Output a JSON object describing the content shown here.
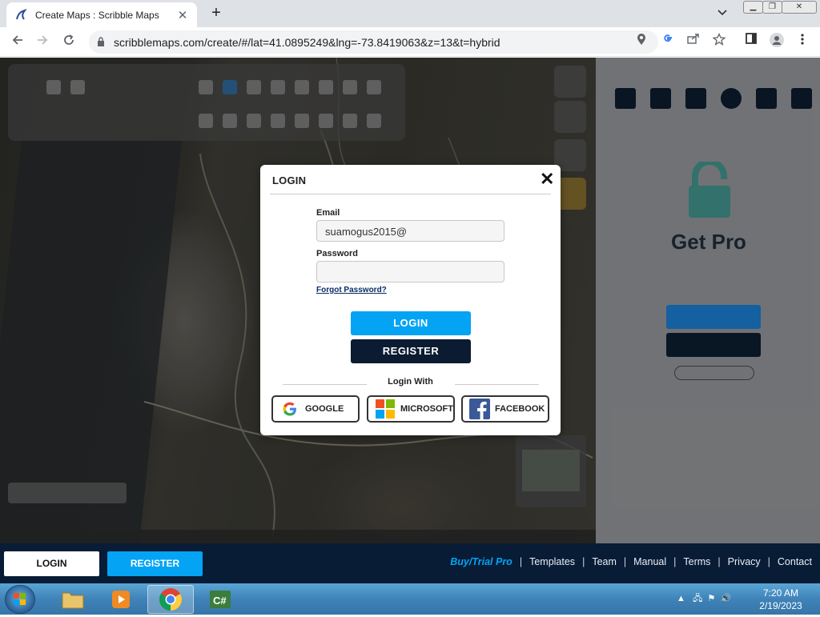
{
  "browser": {
    "tab_title": "Create Maps : Scribble Maps",
    "tab_close": "✕",
    "new_tab": "+",
    "url": "scribblemaps.com/create/#/lat=41.0895249&lng=-73.8419063&z=13&t=hybrid",
    "icons": [
      "back-arrow-icon",
      "forward-arrow-icon",
      "reload-icon",
      "lock-icon",
      "location-pin-icon",
      "google-icon",
      "share-icon",
      "star-icon",
      "sidebar-icon",
      "profile-icon",
      "kebab-menu-icon"
    ]
  },
  "login_dialog": {
    "title": "LOGIN",
    "close": "✕",
    "email_label": "Email",
    "email_value": "suamogus2015@",
    "password_label": "Password",
    "password_value": "",
    "forgot_password": "Forgot Password?",
    "login_button": "LOGIN",
    "register_button": "REGISTER",
    "login_with": "Login With",
    "social": [
      {
        "label": "GOOGLE",
        "icon": "google-icon"
      },
      {
        "label": "MICROSOFT",
        "icon": "microsoft-icon"
      },
      {
        "label": "FACEBOOK",
        "icon": "facebook-icon"
      }
    ]
  },
  "side_panel": {
    "heading": "Get Pro"
  },
  "bottom_bar": {
    "login": "LOGIN",
    "register": "REGISTER",
    "links": [
      "Buy/Trial Pro",
      "Templates",
      "Team",
      "Manual",
      "Terms",
      "Privacy",
      "Contact"
    ],
    "link_colors": {
      "pro": "#05a3f4",
      "default": "#e9eef5"
    }
  },
  "taskbar": {
    "time": "7:20 AM",
    "date": "2/19/2023",
    "apps": [
      "file-explorer-icon",
      "media-player-icon",
      "chrome-icon",
      "csharp-icon"
    ]
  },
  "colors": {
    "accent": "#05a3f4",
    "navy": "#0b1b31",
    "bottombar": "#081c36"
  }
}
